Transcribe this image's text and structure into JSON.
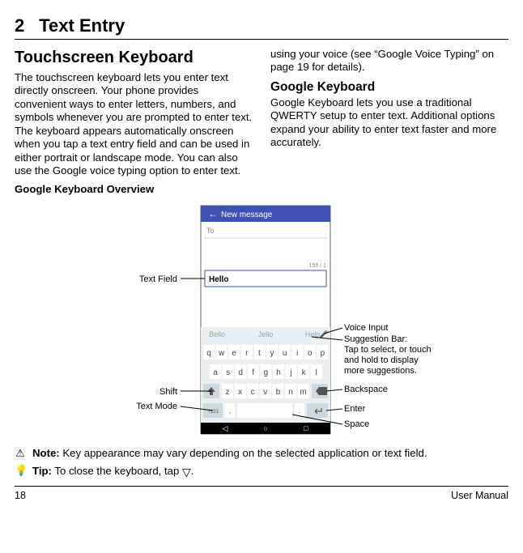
{
  "chapter": {
    "number": "2",
    "title": "Text Entry"
  },
  "col1": {
    "h2": "Touchscreen Keyboard",
    "body": "The touchscreen keyboard lets you enter text directly onscreen. Your phone provides convenient ways to enter letters, numbers, and symbols whenever you are prompted to enter text. The keyboard appears automatically onscreen when you tap a text entry field and can be used in either portrait or landscape mode. You can also use the Google voice typing option to enter text.",
    "overview_label": "Google Keyboard Overview"
  },
  "col2": {
    "cont": "using your voice (see “Google Voice Typing” on page 19 for details).",
    "h3": "Google Keyboard",
    "body": "Google Keyboard lets you use a traditional QWERTY setup to enter text. Additional options expand your ability to enter text faster and more accurately."
  },
  "figure": {
    "app_title": "New message",
    "to_label": "To",
    "counter": "155 / 1",
    "text_value": "Hello",
    "suggestions": [
      "Bello",
      "Jello",
      "Help"
    ],
    "row1": [
      "q",
      "w",
      "e",
      "r",
      "t",
      "y",
      "u",
      "i",
      "o",
      "p"
    ],
    "row2": [
      "a",
      "s",
      "d",
      "f",
      "g",
      "h",
      "j",
      "k",
      "l"
    ],
    "row3": [
      "z",
      "x",
      "c",
      "v",
      "b",
      "n",
      "m"
    ],
    "mode_label": "?123",
    "labels": {
      "text_field": "Text Field",
      "voice": "Voice Input",
      "sugg": "Suggestion Bar:",
      "sugg2": "Tap to select, or touch",
      "sugg3": "and hold to display",
      "sugg4": "more suggestions.",
      "backspace": "Backspace",
      "shift": "Shift",
      "text_mode": "Text Mode",
      "enter": "Enter",
      "space": "Space"
    }
  },
  "note": {
    "label": "Note:",
    "text": " Key appearance may vary depending on the selected application or text field."
  },
  "tip": {
    "label": "Tip:",
    "text1": " To close the keyboard, tap ",
    "text2": "."
  },
  "footer": {
    "page": "18",
    "doc": "User Manual"
  }
}
